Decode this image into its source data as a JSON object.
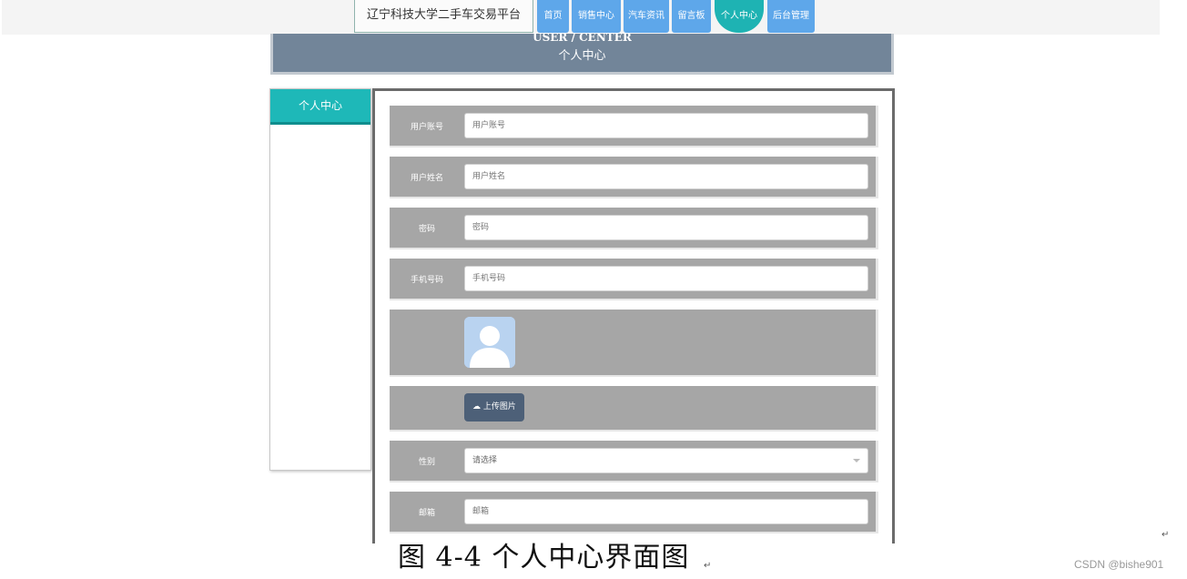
{
  "header": {
    "site_title": "辽宁科技大学二手车交易平台",
    "nav": [
      {
        "label": "首页"
      },
      {
        "label": "销售中心"
      },
      {
        "label": "汽车资讯"
      },
      {
        "label": "留言板"
      },
      {
        "label": "个人中心",
        "active": true
      },
      {
        "label": "后台管理"
      }
    ]
  },
  "banner": {
    "en": "USER / CENTER",
    "cn": "个人中心"
  },
  "sidebar": {
    "items": [
      {
        "label": "个人中心"
      }
    ]
  },
  "form": {
    "account": {
      "label": "用户账号",
      "placeholder": "用户账号"
    },
    "name": {
      "label": "用户姓名",
      "placeholder": "用户姓名"
    },
    "password": {
      "label": "密码",
      "placeholder": "密码"
    },
    "phone": {
      "label": "手机号码",
      "placeholder": "手机号码"
    },
    "upload_label": "上传图片",
    "gender": {
      "label": "性别",
      "value": "请选择"
    },
    "email": {
      "label": "邮箱",
      "placeholder": "邮箱"
    }
  },
  "caption": "图 4-4 个人中心界面图",
  "watermark": "CSDN @bishe901",
  "colors": {
    "nav": "#5ea7ea",
    "active": "#1eb3b3",
    "banner": "#728599",
    "row": "#a6a6a6",
    "upload": "#4d6078"
  }
}
